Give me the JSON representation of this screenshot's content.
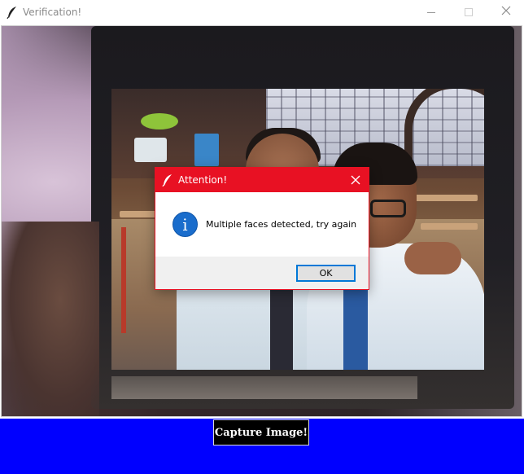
{
  "window": {
    "title": "Verification!",
    "icon": "feather-icon",
    "controls": {
      "minimize": "minimize",
      "maximize": "maximize",
      "close": "close"
    }
  },
  "camera": {
    "description_icon": "camera-feed"
  },
  "dialog": {
    "title": "Attention!",
    "icon": "info-icon",
    "info_glyph": "i",
    "message": "Multiple faces detected, try again",
    "ok_label": "OK",
    "accent_color": "#e81123"
  },
  "bottom": {
    "capture_label": "Capture Image!",
    "panel_color": "#0000ff"
  }
}
